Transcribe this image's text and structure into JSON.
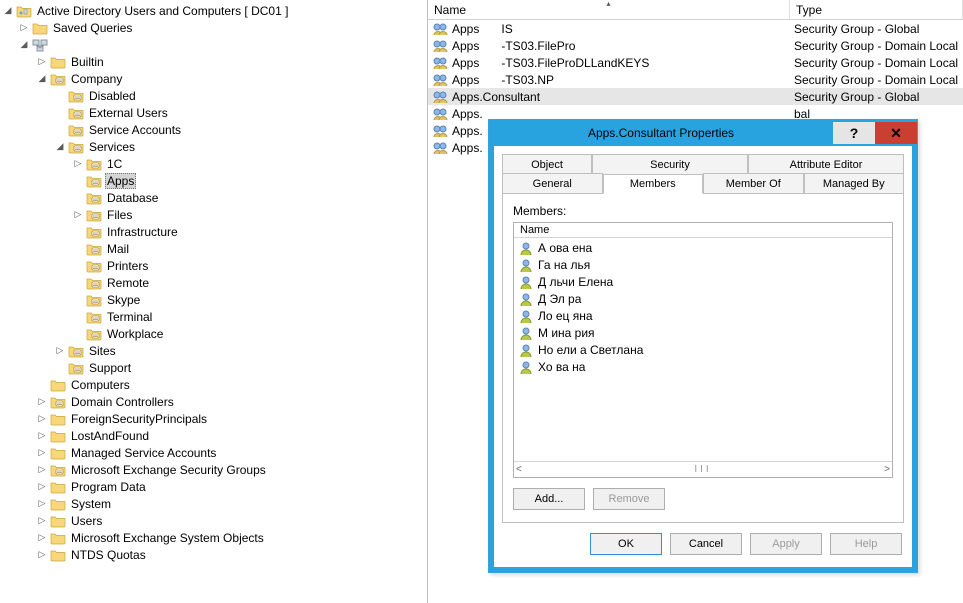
{
  "root_label": "Active Directory Users and Computers [      DC01                              ]",
  "tree": {
    "saved_queries": "Saved Queries",
    "domain_root": "",
    "builtin": "Builtin",
    "company": "Company",
    "disabled": "Disabled",
    "external_users": "External Users",
    "service_accounts": "Service Accounts",
    "services": "Services",
    "svc_1c": "1C",
    "svc_apps": "Apps",
    "svc_database": "Database",
    "svc_files": "Files",
    "svc_infra": "Infrastructure",
    "svc_mail": "Mail",
    "svc_printers": "Printers",
    "svc_remote": "Remote",
    "svc_skype": "Skype",
    "svc_terminal": "Terminal",
    "svc_workplace": "Workplace",
    "sites": "Sites",
    "support": "Support",
    "computers": "Computers",
    "domain_controllers": "Domain Controllers",
    "fsp": "ForeignSecurityPrincipals",
    "lost": "LostAndFound",
    "msa": "Managed Service Accounts",
    "mesg": "Microsoft Exchange Security Groups",
    "program_data": "Program Data",
    "system": "System",
    "users": "Users",
    "meso": "Microsoft Exchange System Objects",
    "ntds": "NTDS Quotas"
  },
  "list": {
    "col_name": "Name",
    "col_type": "Type",
    "rows": [
      {
        "name": "Apps",
        "suffix": "IS",
        "type": "Security Group - Global"
      },
      {
        "name": "Apps",
        "suffix": "-TS03.FilePro",
        "type": "Security Group - Domain Local"
      },
      {
        "name": "Apps",
        "suffix": "-TS03.FileProDLLandKEYS",
        "type": "Security Group - Domain Local"
      },
      {
        "name": "Apps",
        "suffix": "-TS03.NP",
        "type": "Security Group - Domain Local"
      },
      {
        "name": "Apps.Consultant",
        "suffix": "",
        "type": "Security Group - Global",
        "selected": true
      },
      {
        "name": "Apps.",
        "suffix": "",
        "type": "bal"
      },
      {
        "name": "Apps.",
        "suffix": "",
        "type": "bal"
      },
      {
        "name": "Apps.",
        "suffix": "",
        "type": "bal"
      }
    ]
  },
  "dialog": {
    "title": "Apps.Consultant Properties",
    "tabs_top": {
      "object": "Object",
      "security": "Security",
      "attr": "Attribute Editor"
    },
    "tabs_bot": {
      "general": "General",
      "members": "Members",
      "member_of": "Member Of",
      "managed_by": "Managed By"
    },
    "members_label": "Members:",
    "col_name": "Name",
    "members": [
      "А        ова      ена",
      "Га       на      лья",
      "Д        льчи     Елена",
      "Д        Эл       ра",
      "Ло       ец       яна",
      "М        ина      рия",
      "Но       ели      а Светлана",
      "Хо       ва        на"
    ],
    "add": "Add...",
    "remove": "Remove",
    "ok": "OK",
    "cancel": "Cancel",
    "apply": "Apply",
    "help": "Help"
  }
}
